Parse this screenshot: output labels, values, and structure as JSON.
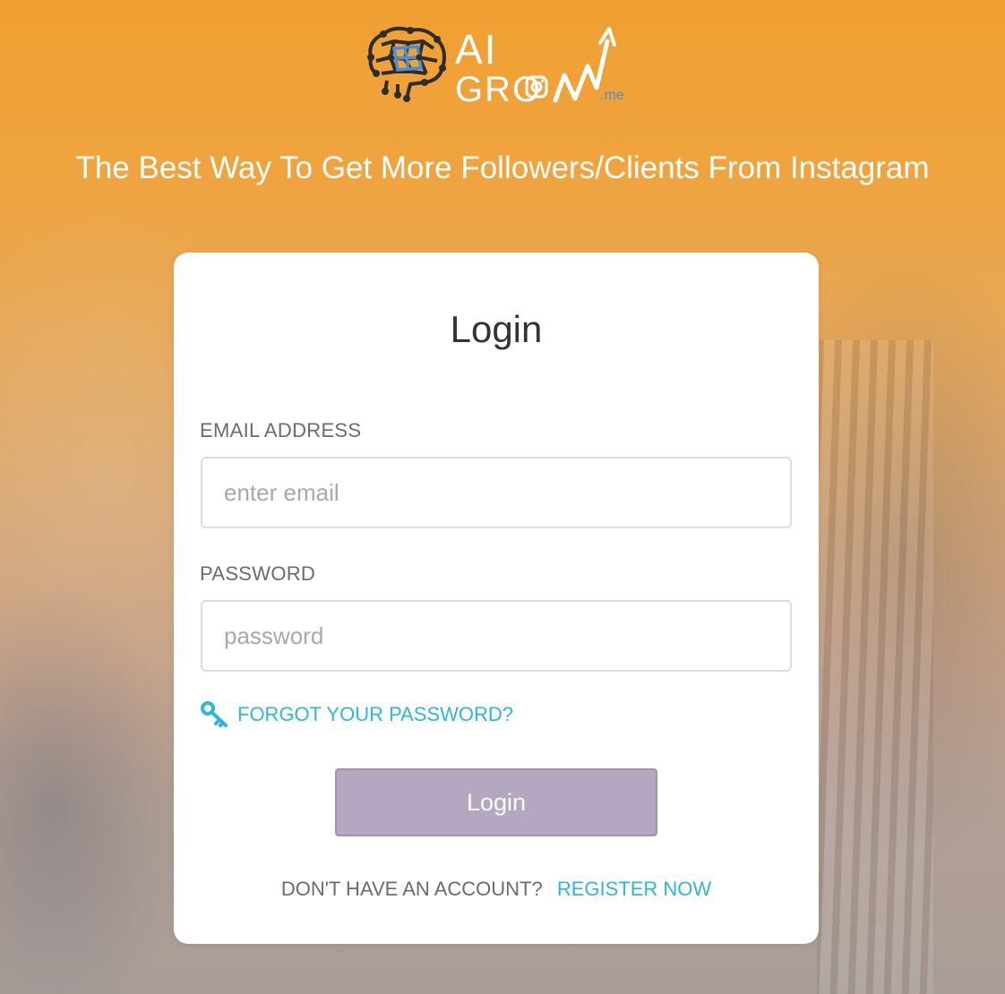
{
  "brand": {
    "line1": "AI",
    "line2": "GRO",
    "suffix": ".me"
  },
  "tagline": "The Best Way To Get More Followers/Clients From Instagram",
  "login_card": {
    "title": "Login",
    "email": {
      "label": "EMAIL ADDRESS",
      "placeholder": "enter email",
      "value": ""
    },
    "password": {
      "label": "PASSWORD",
      "placeholder": "password",
      "value": ""
    },
    "forgot_link": "FORGOT YOUR PASSWORD?",
    "login_button": "Login",
    "register_prompt": "DON'T HAVE AN ACCOUNT?",
    "register_link": "REGISTER NOW"
  },
  "colors": {
    "accent_link": "#2cb8dd",
    "button_bg": "#b3a7c1",
    "background_top": "#f0a030",
    "logo_blue": "#4a8fd8"
  },
  "icons": {
    "logo": "brain-network-icon",
    "forgot": "key-icon",
    "instagram": "instagram-icon",
    "growth": "growth-arrow-icon"
  }
}
